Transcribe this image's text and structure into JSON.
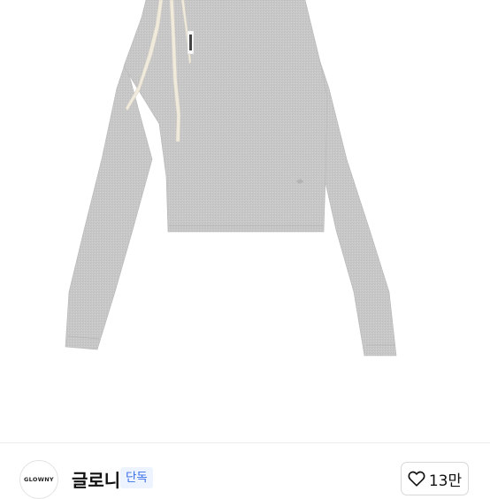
{
  "product": {
    "image_alt": "grey ribbed long-sleeve top with ribbon ties",
    "colors": {
      "knit": "#c6c6c6",
      "ribbon": "#f0eadc",
      "background": "#ffffff"
    }
  },
  "brand": {
    "logo_text": "GLOWNY",
    "name": "글로니",
    "badge": "단독"
  },
  "like": {
    "icon": "heart-outline-icon",
    "count": "13만"
  }
}
